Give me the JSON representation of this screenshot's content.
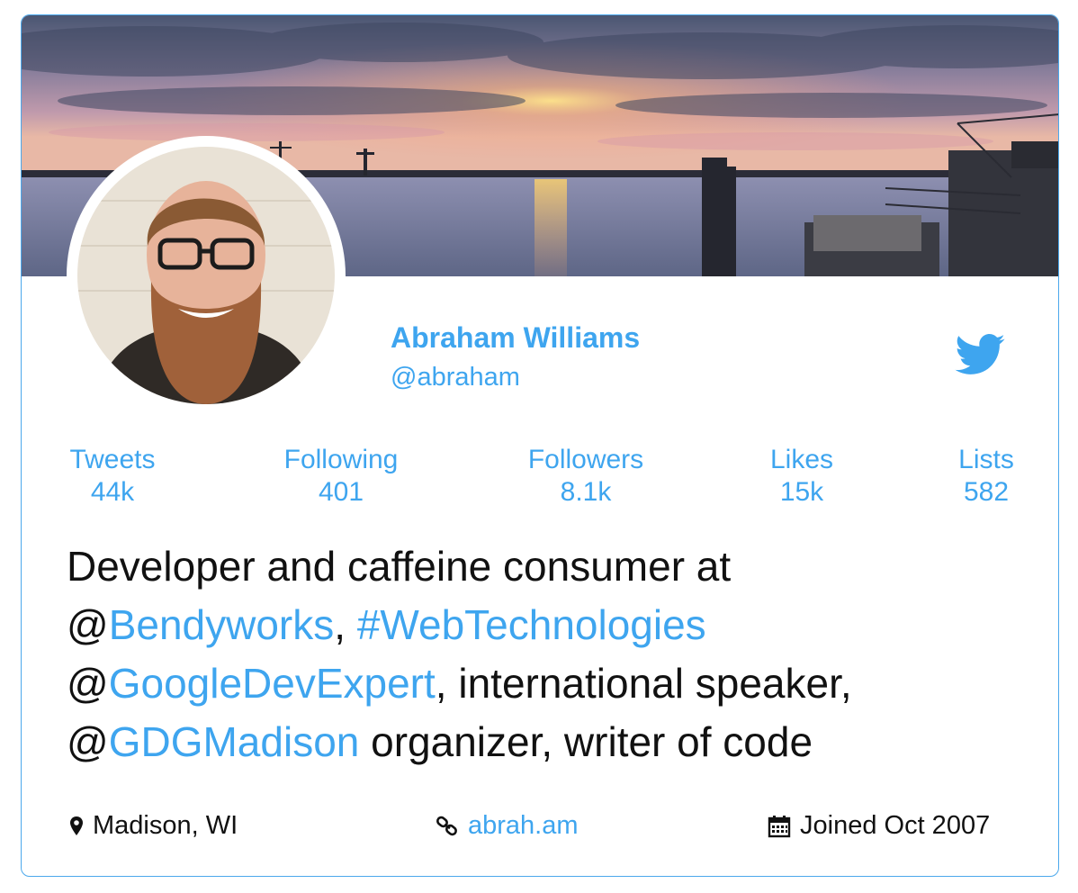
{
  "profile": {
    "name": "Abraham Williams",
    "handle": "@abraham",
    "twitter_icon": "twitter-bird-icon"
  },
  "stats": [
    {
      "label": "Tweets",
      "value": "44k"
    },
    {
      "label": "Following",
      "value": "401"
    },
    {
      "label": "Followers",
      "value": "8.1k"
    },
    {
      "label": "Likes",
      "value": "15k"
    },
    {
      "label": "Lists",
      "value": "582"
    }
  ],
  "bio": {
    "line1": "Developer and caffeine consumer at",
    "at1": "@",
    "mention1": "Bendyworks",
    "comma1": ", ",
    "hashtag": "#WebTechnologies",
    "at2": "@",
    "mention2": "GoogleDevExpert",
    "text2": ", international speaker,",
    "at3": "@",
    "mention3": "GDGMadison",
    "text3": " organizer, writer of code"
  },
  "meta": {
    "location": "Madison, WI",
    "location_icon": "map-pin-icon",
    "website": "abrah.am",
    "website_icon": "link-icon",
    "joined": "Joined Oct 2007",
    "joined_icon": "calendar-icon"
  },
  "colors": {
    "accent": "#3ea5ef",
    "border": "#4ba8ec",
    "text": "#111111"
  }
}
